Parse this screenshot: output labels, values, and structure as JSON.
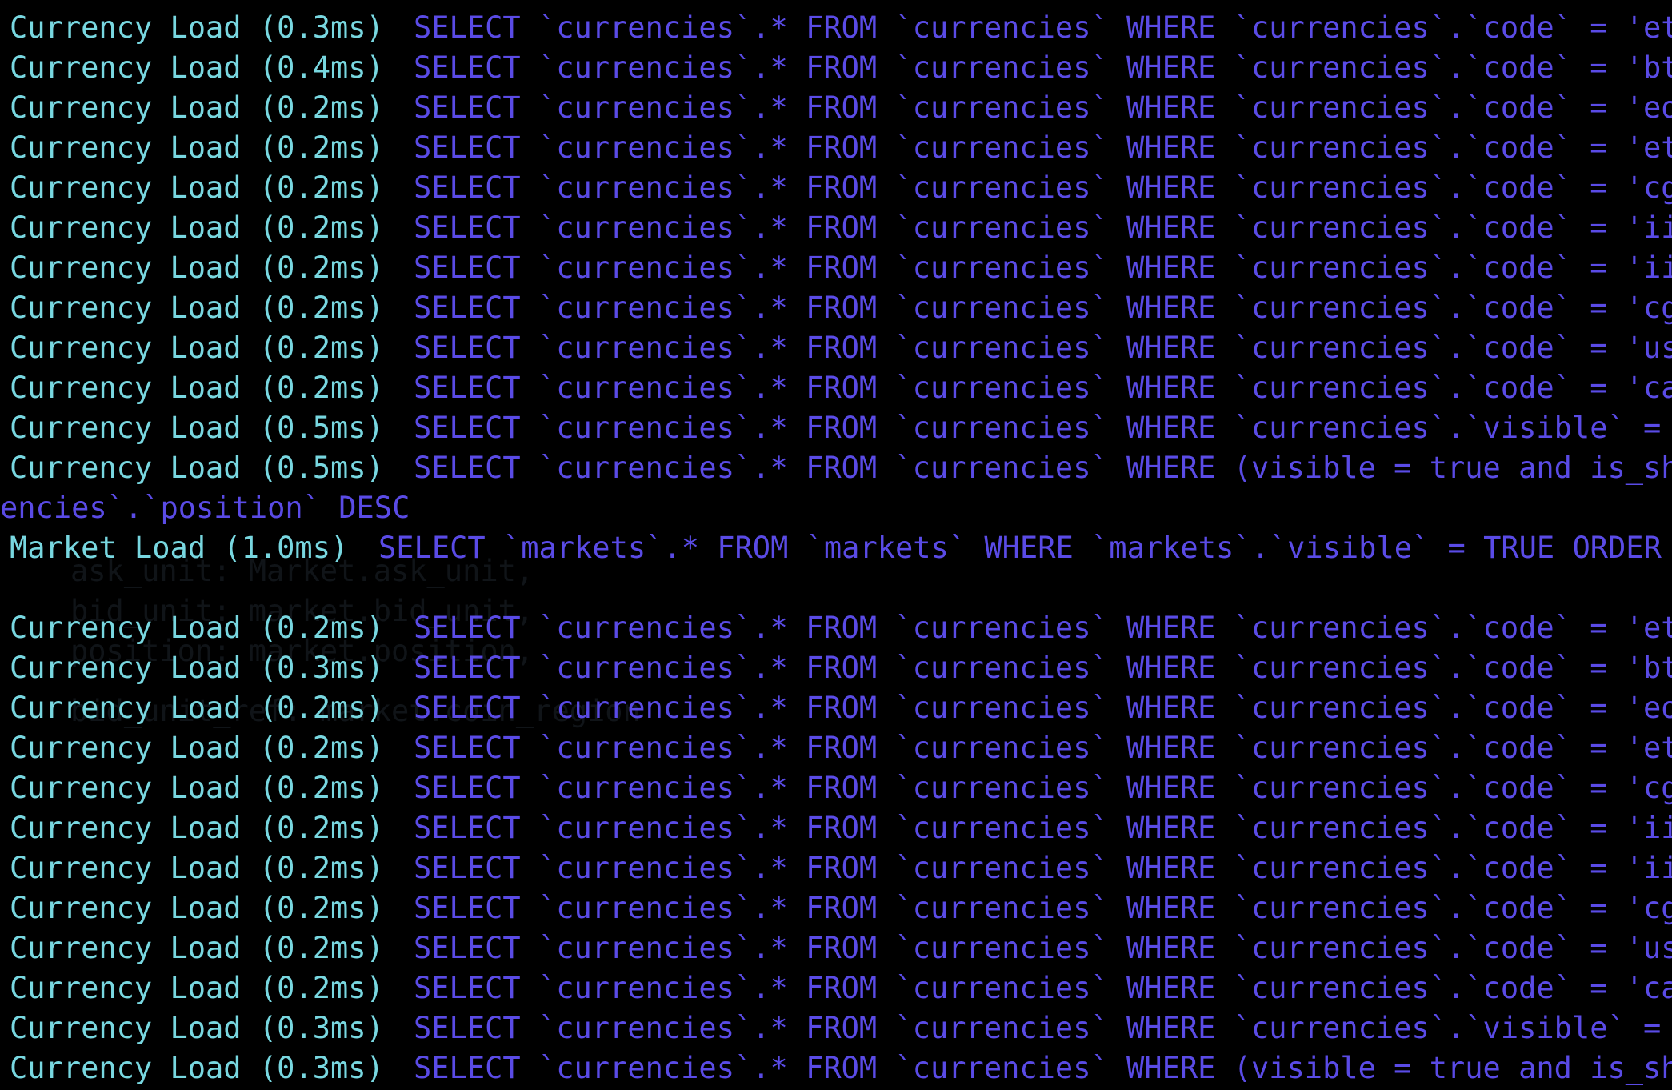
{
  "colors": {
    "background": "#000000",
    "log_tag": "#78d7e0",
    "sql": "#5a4be6"
  },
  "ghost_text": [
    "ask_unit: Market.ask_unit,",
    "bid_unit: market.bid_unit,",
    "position: market.position,",
    "bid_unit_ref: market.coin_region"
  ],
  "log_lines": [
    {
      "tag": "Currency Load (0.3ms)",
      "sql": "SELECT `currencies`.* FROM `currencies` WHERE `currencies`.`code` = 'eth"
    },
    {
      "tag": "Currency Load (0.4ms)",
      "sql": "SELECT `currencies`.* FROM `currencies` WHERE `currencies`.`code` = 'btc"
    },
    {
      "tag": "Currency Load (0.2ms)",
      "sql": "SELECT `currencies`.* FROM `currencies` WHERE `currencies`.`code` = 'eos"
    },
    {
      "tag": "Currency Load (0.2ms)",
      "sql": "SELECT `currencies`.* FROM `currencies` WHERE `currencies`.`code` = 'eth"
    },
    {
      "tag": "Currency Load (0.2ms)",
      "sql": "SELECT `currencies`.* FROM `currencies` WHERE `currencies`.`code` = 'cg'"
    },
    {
      "tag": "Currency Load (0.2ms)",
      "sql": "SELECT `currencies`.* FROM `currencies` WHERE `currencies`.`code` = 'ii'"
    },
    {
      "tag": "Currency Load (0.2ms)",
      "sql": "SELECT `currencies`.* FROM `currencies` WHERE `currencies`.`code` = 'ii'"
    },
    {
      "tag": "Currency Load (0.2ms)",
      "sql": "SELECT `currencies`.* FROM `currencies` WHERE `currencies`.`code` = 'cg'"
    },
    {
      "tag": "Currency Load (0.2ms)",
      "sql": "SELECT `currencies`.* FROM `currencies` WHERE `currencies`.`code` = 'usd"
    },
    {
      "tag": "Currency Load (0.2ms)",
      "sql": "SELECT `currencies`.* FROM `currencies` WHERE `currencies`.`code` = 'cab"
    },
    {
      "tag": "Currency Load (0.5ms)",
      "sql": "SELECT `currencies`.* FROM `currencies` WHERE `currencies`.`visible` = T"
    },
    {
      "tag": "Currency Load (0.5ms)",
      "sql": "SELECT `currencies`.* FROM `currencies` WHERE (visible = true and is_sho"
    },
    {
      "tag": "",
      "sql": "encies`.`position` DESC",
      "wrapped": true
    },
    {
      "tag": "Market Load (1.0ms)",
      "sql": "SELECT `markets`.* FROM `markets` WHERE `markets`.`visible` = TRUE ORDER B",
      "market": true
    },
    {
      "tag": "",
      "sql": ""
    },
    {
      "tag": "Currency Load (0.2ms)",
      "sql": "SELECT `currencies`.* FROM `currencies` WHERE `currencies`.`code` = 'eth"
    },
    {
      "tag": "Currency Load (0.3ms)",
      "sql": "SELECT `currencies`.* FROM `currencies` WHERE `currencies`.`code` = 'btc"
    },
    {
      "tag": "Currency Load (0.2ms)",
      "sql": "SELECT `currencies`.* FROM `currencies` WHERE `currencies`.`code` = 'eos"
    },
    {
      "tag": "Currency Load (0.2ms)",
      "sql": "SELECT `currencies`.* FROM `currencies` WHERE `currencies`.`code` = 'eth"
    },
    {
      "tag": "Currency Load (0.2ms)",
      "sql": "SELECT `currencies`.* FROM `currencies` WHERE `currencies`.`code` = 'cg'"
    },
    {
      "tag": "Currency Load (0.2ms)",
      "sql": "SELECT `currencies`.* FROM `currencies` WHERE `currencies`.`code` = 'ii'"
    },
    {
      "tag": "Currency Load (0.2ms)",
      "sql": "SELECT `currencies`.* FROM `currencies` WHERE `currencies`.`code` = 'ii'"
    },
    {
      "tag": "Currency Load (0.2ms)",
      "sql": "SELECT `currencies`.* FROM `currencies` WHERE `currencies`.`code` = 'cg'"
    },
    {
      "tag": "Currency Load (0.2ms)",
      "sql": "SELECT `currencies`.* FROM `currencies` WHERE `currencies`.`code` = 'usd"
    },
    {
      "tag": "Currency Load (0.2ms)",
      "sql": "SELECT `currencies`.* FROM `currencies` WHERE `currencies`.`code` = 'cab"
    },
    {
      "tag": "Currency Load (0.3ms)",
      "sql": "SELECT `currencies`.* FROM `currencies` WHERE `currencies`.`visible` = T"
    },
    {
      "tag": "Currency Load (0.3ms)",
      "sql": "SELECT `currencies`.* FROM `currencies` WHERE (visible = true and is_sho"
    }
  ]
}
